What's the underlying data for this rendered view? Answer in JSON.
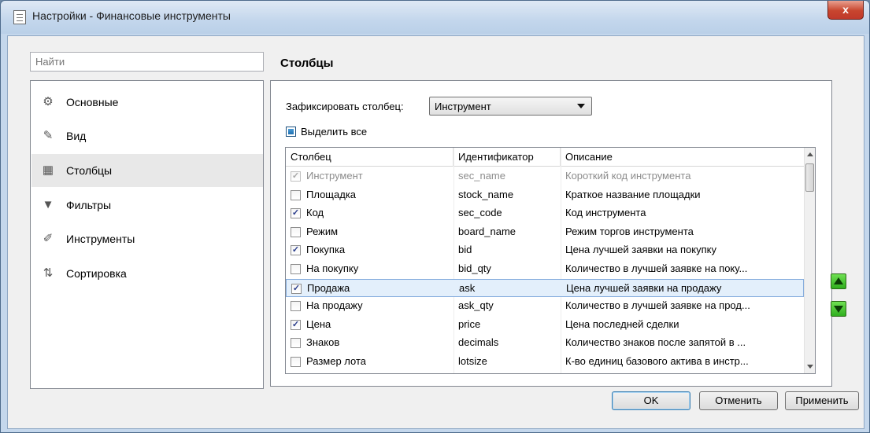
{
  "window": {
    "title": "Настройки - Финансовые инструменты",
    "close_glyph": "x"
  },
  "search": {
    "placeholder": "Найти"
  },
  "sidebar": {
    "items": [
      {
        "label": "Основные",
        "icon": "gear-icon",
        "glyph": "⚙"
      },
      {
        "label": "Вид",
        "icon": "brush-icon",
        "glyph": "✎"
      },
      {
        "label": "Столбцы",
        "icon": "columns-icon",
        "glyph": "▦"
      },
      {
        "label": "Фильтры",
        "icon": "filter-icon",
        "glyph": "▼"
      },
      {
        "label": "Инструменты",
        "icon": "tools-icon",
        "glyph": "✐"
      },
      {
        "label": "Сортировка",
        "icon": "sort-az-icon",
        "glyph": "⇅"
      }
    ],
    "active_index": 2
  },
  "main": {
    "section_title": "Столбцы",
    "fix_column_label": "Зафиксировать столбец:",
    "fix_column_value": "Инструмент",
    "select_all_label": "Выделить все",
    "columns_header": [
      "Столбец",
      "Идентификатор",
      "Описание"
    ],
    "rows": [
      {
        "checked": true,
        "disabled": true,
        "name": "Инструмент",
        "id": "sec_name",
        "desc": "Короткий код инструмента"
      },
      {
        "checked": false,
        "disabled": false,
        "name": "Площадка",
        "id": "stock_name",
        "desc": "Краткое название площадки"
      },
      {
        "checked": true,
        "disabled": false,
        "name": "Код",
        "id": "sec_code",
        "desc": "Код инструмента"
      },
      {
        "checked": false,
        "disabled": false,
        "name": "Режим",
        "id": "board_name",
        "desc": "Режим торгов инструмента"
      },
      {
        "checked": true,
        "disabled": false,
        "name": "Покупка",
        "id": "bid",
        "desc": "Цена лучшей заявки на покупку"
      },
      {
        "checked": false,
        "disabled": false,
        "name": "На покупку",
        "id": "bid_qty",
        "desc": "Количество в лучшей заявке на поку..."
      },
      {
        "checked": true,
        "disabled": false,
        "selected": true,
        "name": "Продажа",
        "id": "ask",
        "desc": "Цена лучшей заявки на продажу"
      },
      {
        "checked": false,
        "disabled": false,
        "name": "На продажу",
        "id": "ask_qty",
        "desc": "Количество в лучшей заявке на прод..."
      },
      {
        "checked": true,
        "disabled": false,
        "name": "Цена",
        "id": "price",
        "desc": "Цена последней сделки"
      },
      {
        "checked": false,
        "disabled": false,
        "name": "Знаков",
        "id": "decimals",
        "desc": "Количество знаков после запятой в ..."
      },
      {
        "checked": false,
        "disabled": false,
        "name": "Размер лота",
        "id": "lotsize",
        "desc": "К-во единиц базового актива в инстр..."
      }
    ]
  },
  "buttons": {
    "ok": "OK",
    "cancel": "Отменить",
    "apply": "Применить"
  },
  "colors": {
    "accent": "#2fae1e",
    "selection": "#e3effb",
    "selection_border": "#84acdd"
  }
}
